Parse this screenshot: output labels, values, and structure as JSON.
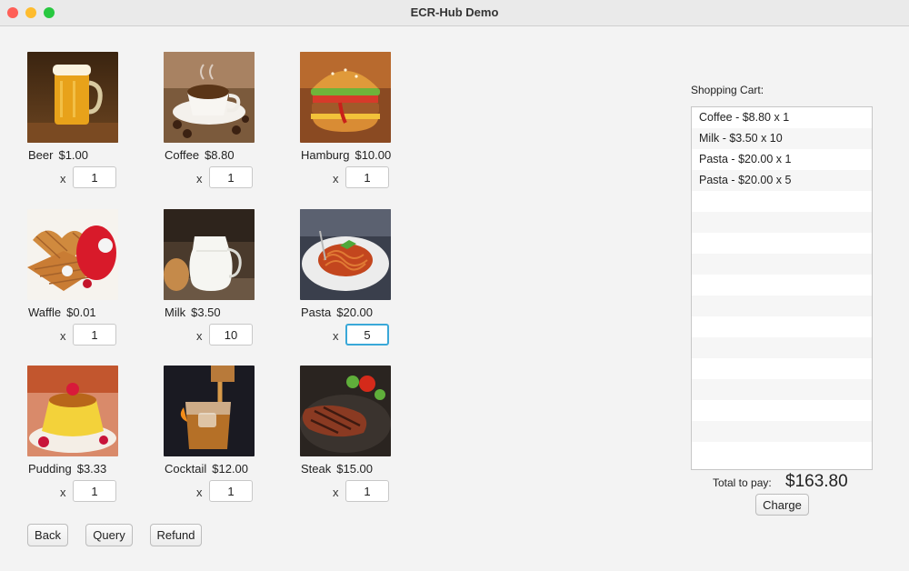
{
  "window": {
    "title": "ECR-Hub Demo"
  },
  "products": [
    {
      "name": "Beer",
      "price": "$1.00",
      "qty": "1",
      "image_icon": "beer-mug-icon"
    },
    {
      "name": "Coffee",
      "price": "$8.80",
      "qty": "1",
      "image_icon": "coffee-cup-icon"
    },
    {
      "name": "Hamburg",
      "price": "$10.00",
      "qty": "1",
      "image_icon": "hamburger-icon"
    },
    {
      "name": "Waffle",
      "price": "$0.01",
      "qty": "1",
      "image_icon": "waffle-icon"
    },
    {
      "name": "Milk",
      "price": "$3.50",
      "qty": "10",
      "image_icon": "milk-jug-icon"
    },
    {
      "name": "Pasta",
      "price": "$20.00",
      "qty": "5",
      "image_icon": "pasta-plate-icon",
      "focused": true
    },
    {
      "name": "Pudding",
      "price": "$3.33",
      "qty": "1",
      "image_icon": "pudding-icon"
    },
    {
      "name": "Cocktail",
      "price": "$12.00",
      "qty": "1",
      "image_icon": "cocktail-glass-icon"
    },
    {
      "name": "Steak",
      "price": "$15.00",
      "qty": "1",
      "image_icon": "steak-icon"
    }
  ],
  "qty_multiplier": "x",
  "buttons": {
    "back": "Back",
    "query": "Query",
    "refund": "Refund"
  },
  "cart": {
    "label": "Shopping Cart:",
    "items": [
      "Coffee - $8.80 x 1",
      "Milk - $3.50 x 10",
      "Pasta - $20.00 x 1",
      "Pasta - $20.00 x 5"
    ],
    "total_label": "Total to pay:",
    "total_value": "$163.80",
    "charge_label": "Charge"
  }
}
